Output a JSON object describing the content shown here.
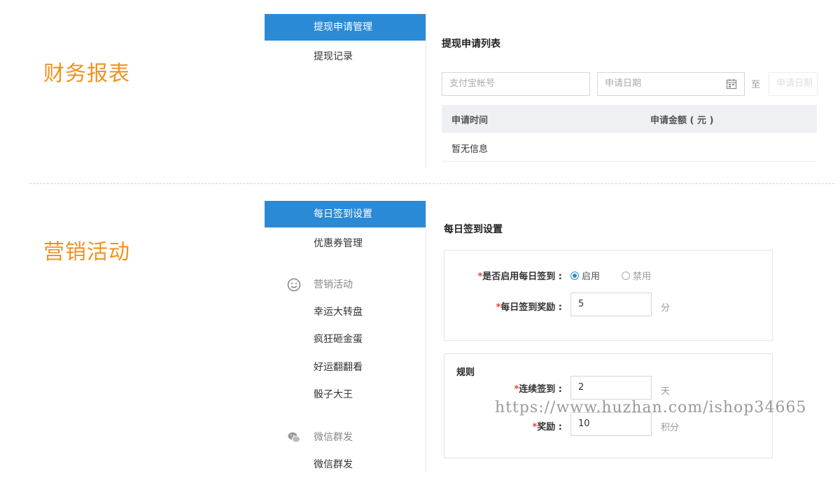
{
  "finance": {
    "section_title": "财务报表",
    "menu": {
      "active": "提现申请管理",
      "items": [
        "提现记录"
      ]
    },
    "panel_title": "提现申请列表",
    "filter": {
      "alipay_placeholder": "支付宝帐号",
      "date_placeholder": "申请日期",
      "to_label": "至",
      "date_end_placeholder": "申请日期"
    },
    "table": {
      "columns": [
        "申请时间",
        "申请金额 ( 元 )"
      ],
      "empty": "暂无信息"
    }
  },
  "marketing": {
    "section_title": "营销活动",
    "menu": {
      "active": "每日签到设置",
      "items": [
        "优惠券管理"
      ],
      "groups": [
        {
          "label": "营销活动",
          "icon": "smiley-icon",
          "items": [
            "幸运大转盘",
            "疯狂砸金蛋",
            "好运翻翻看",
            "骰子大王"
          ]
        },
        {
          "label": "微信群发",
          "icon": "wechat-icon",
          "items": [
            "微信群发"
          ]
        }
      ]
    },
    "panel_title": "每日签到设置",
    "signin": {
      "enable_label": "是否启用每日签到 :",
      "enable_option": "启用",
      "disable_option": "禁用",
      "reward_label": "每日签到奖励 :",
      "reward_value": "5",
      "reward_unit": "分"
    },
    "rules": {
      "title": "规则",
      "days_label": "连续签到 :",
      "days_value": "2",
      "days_unit": "天",
      "bonus_label": "奖励 :",
      "bonus_value": "10",
      "bonus_unit": "积分"
    }
  },
  "watermark": "https://www.huzhan.com/ishop34665",
  "colors": {
    "accent": "#2a8ad6",
    "section_title": "#f0921e",
    "required": "#e8413b"
  }
}
